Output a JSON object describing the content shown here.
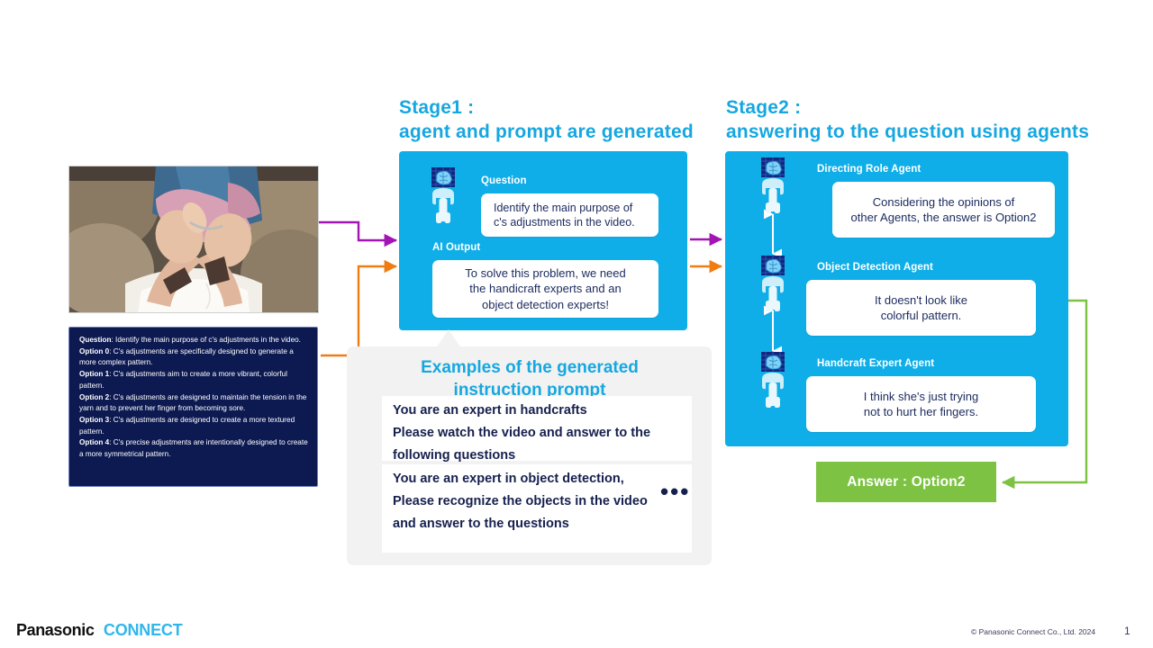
{
  "slide": {
    "stage1": {
      "heading": "Stage1 :\nagent and prompt are generated",
      "question_label": "Question",
      "question_text": "Identify the main purpose of\nc's adjustments in the video.",
      "ai_output_label": "AI Output",
      "ai_output_text": "To solve this problem, we need\nthe handicraft experts and an\nobject detection experts!"
    },
    "stage2": {
      "heading": "Stage2 :\nanswering to the question using agents",
      "agents": [
        {
          "label": "Directing Role Agent",
          "message": "Considering the opinions of\nother Agents, the answer is Option2"
        },
        {
          "label": "Object Detection Agent",
          "message": "It doesn't look like\ncolorful pattern."
        },
        {
          "label": "Handcraft Expert Agent",
          "message": "I think she's just trying\nnot to hurt her fingers."
        }
      ]
    },
    "question_card": {
      "question_label": "Question",
      "question_text": "Identify the main purpose of c's adjustments in the video.",
      "options": [
        {
          "label": "Option 0",
          "text": "C's adjustments are specifically designed to generate a more complex pattern."
        },
        {
          "label": "Option 1",
          "text": "C's adjustments aim to create a more vibrant, colorful pattern."
        },
        {
          "label": "Option 2",
          "text": "C's adjustments are designed to maintain the tension in the yarn and to prevent her finger from becoming sore."
        },
        {
          "label": "Option 3",
          "text": "C's adjustments are designed to create a more textured pattern."
        },
        {
          "label": "Option 4",
          "text": "C's precise adjustments are intentionally designed to create a more symmetrical pattern."
        }
      ]
    },
    "examples": {
      "title": "Examples of the generated\ninstruction prompt",
      "prompts": [
        "You are an expert in handcrafts\nPlease watch the video and answer to the\n following questions",
        "You are an expert in object detection,\nPlease recognize the objects in the video\nand answer to the questions"
      ],
      "ellipsis": "•••"
    },
    "answer": {
      "text": "Answer : Option2"
    },
    "footer": {
      "logo_primary": "Panasonic",
      "logo_secondary": "CONNECT",
      "copyright": "© Panasonic Connect Co., Ltd. 2024",
      "page_number": "1"
    },
    "colors": {
      "panel_blue": "#0FAEE8",
      "heading_blue": "#16a7e0",
      "answer_green": "#7DC242",
      "arrow_purple": "#A314B4",
      "arrow_orange": "#F07D14",
      "arrow_green": "#7DC242",
      "card_navy": "#0d1a51"
    }
  }
}
